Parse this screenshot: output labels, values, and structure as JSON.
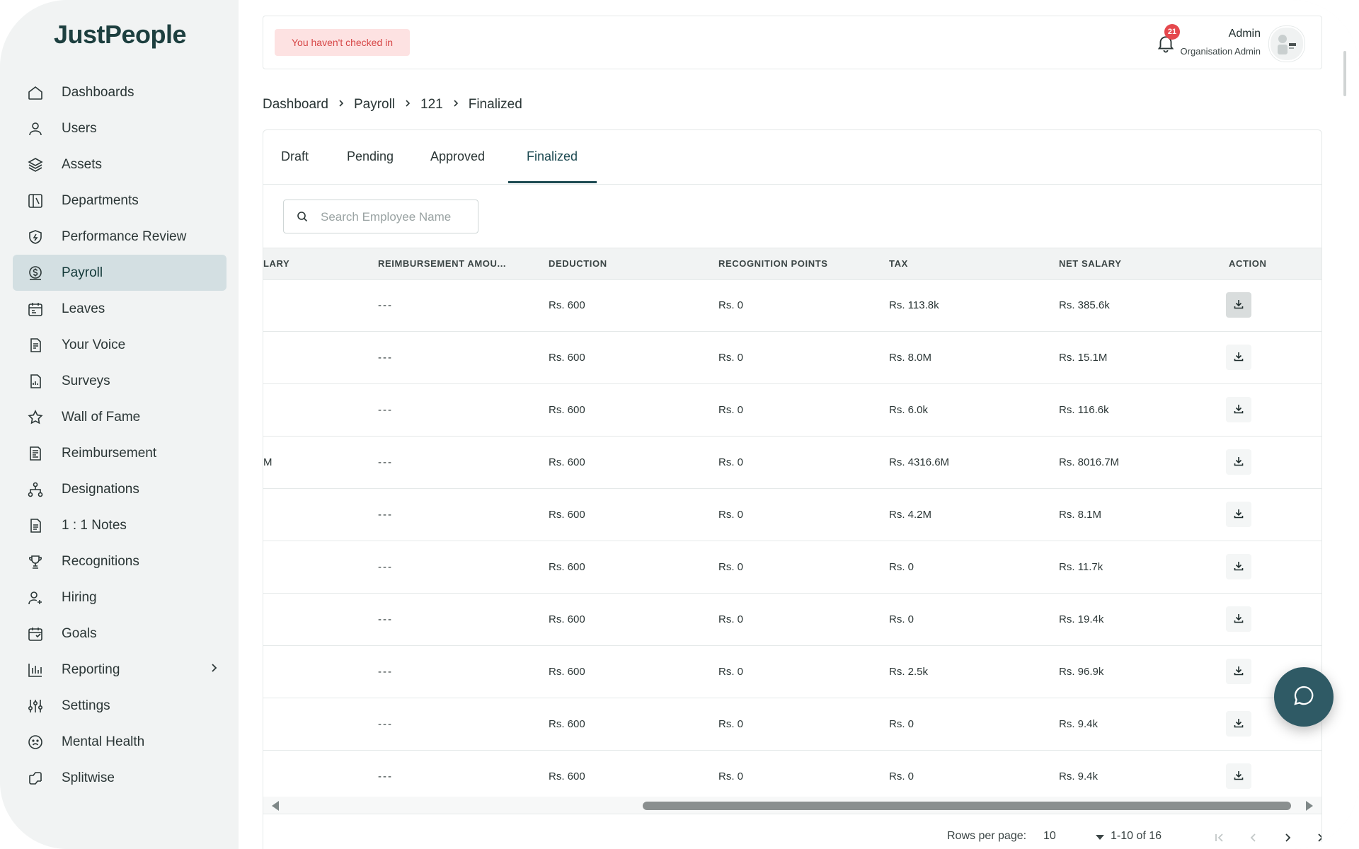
{
  "app": {
    "logo": "JustPeople"
  },
  "sidebar": {
    "items": [
      {
        "label": "Dashboards",
        "icon": "home-icon"
      },
      {
        "label": "Users",
        "icon": "user-icon"
      },
      {
        "label": "Assets",
        "icon": "layers-icon"
      },
      {
        "label": "Departments",
        "icon": "book-icon"
      },
      {
        "label": "Performance Review",
        "icon": "shield-icon"
      },
      {
        "label": "Payroll",
        "icon": "coin-icon",
        "active": true
      },
      {
        "label": "Leaves",
        "icon": "calendar-icon"
      },
      {
        "label": "Your Voice",
        "icon": "document-icon"
      },
      {
        "label": "Surveys",
        "icon": "clipboard-icon"
      },
      {
        "label": "Wall of Fame",
        "icon": "star-icon"
      },
      {
        "label": "Reimbursement",
        "icon": "receipt-icon"
      },
      {
        "label": "Designations",
        "icon": "hierarchy-icon"
      },
      {
        "label": "1 : 1 Notes",
        "icon": "note-icon"
      },
      {
        "label": "Recognitions",
        "icon": "trophy-icon"
      },
      {
        "label": "Hiring",
        "icon": "user-plus-icon"
      },
      {
        "label": "Goals",
        "icon": "calendar-goal-icon"
      },
      {
        "label": "Reporting",
        "icon": "bar-chart-icon",
        "has_submenu": true
      },
      {
        "label": "Settings",
        "icon": "sliders-icon"
      },
      {
        "label": "Mental Health",
        "icon": "face-icon"
      },
      {
        "label": "Splitwise",
        "icon": "split-icon"
      }
    ]
  },
  "header": {
    "checkin_alert": "You haven't checked in",
    "notification_count": "21",
    "user_name": "Admin",
    "user_role": "Organisation Admin"
  },
  "breadcrumb": [
    "Dashboard",
    "Payroll",
    "121",
    "Finalized"
  ],
  "tabs": [
    {
      "label": "Draft"
    },
    {
      "label": "Pending"
    },
    {
      "label": "Approved"
    },
    {
      "label": "Finalized",
      "active": true
    }
  ],
  "search": {
    "placeholder": "Search Employee Name"
  },
  "table": {
    "columns": [
      "LARY",
      "REIMBURSEMENT AMOU...",
      "DEDUCTION",
      "RECOGNITION POINTS",
      "TAX",
      "NET SALARY",
      "ACTION"
    ],
    "rows": [
      {
        "salary": "",
        "reimbursement": "---",
        "deduction": "Rs. 600",
        "recognition": "Rs. 0",
        "tax": "Rs. 113.8k",
        "net": "Rs. 385.6k"
      },
      {
        "salary": "",
        "reimbursement": "---",
        "deduction": "Rs. 600",
        "recognition": "Rs. 0",
        "tax": "Rs. 8.0M",
        "net": "Rs. 15.1M"
      },
      {
        "salary": "",
        "reimbursement": "---",
        "deduction": "Rs. 600",
        "recognition": "Rs. 0",
        "tax": "Rs. 6.0k",
        "net": "Rs. 116.6k"
      },
      {
        "salary": "M",
        "reimbursement": "---",
        "deduction": "Rs. 600",
        "recognition": "Rs. 0",
        "tax": "Rs. 4316.6M",
        "net": "Rs. 8016.7M"
      },
      {
        "salary": "",
        "reimbursement": "---",
        "deduction": "Rs. 600",
        "recognition": "Rs. 0",
        "tax": "Rs. 4.2M",
        "net": "Rs. 8.1M"
      },
      {
        "salary": "",
        "reimbursement": "---",
        "deduction": "Rs. 600",
        "recognition": "Rs. 0",
        "tax": "Rs. 0",
        "net": "Rs. 11.7k"
      },
      {
        "salary": "",
        "reimbursement": "---",
        "deduction": "Rs. 600",
        "recognition": "Rs. 0",
        "tax": "Rs. 0",
        "net": "Rs. 19.4k"
      },
      {
        "salary": "",
        "reimbursement": "---",
        "deduction": "Rs. 600",
        "recognition": "Rs. 0",
        "tax": "Rs. 2.5k",
        "net": "Rs. 96.9k"
      },
      {
        "salary": "",
        "reimbursement": "---",
        "deduction": "Rs. 600",
        "recognition": "Rs. 0",
        "tax": "Rs. 0",
        "net": "Rs. 9.4k"
      },
      {
        "salary": "",
        "reimbursement": "---",
        "deduction": "Rs. 600",
        "recognition": "Rs. 0",
        "tax": "Rs. 0",
        "net": "Rs. 9.4k"
      }
    ]
  },
  "pagination": {
    "rows_per_page_label": "Rows per page:",
    "rows_per_page": "10",
    "range": "1-10 of 16"
  },
  "colors": {
    "brand": "#1d3f3f",
    "active_nav_bg": "#d3dfe2",
    "alert_bg": "#fde2e2",
    "alert_text": "#d64545",
    "badge": "#e5484d",
    "chat_button": "#2f5a65"
  }
}
